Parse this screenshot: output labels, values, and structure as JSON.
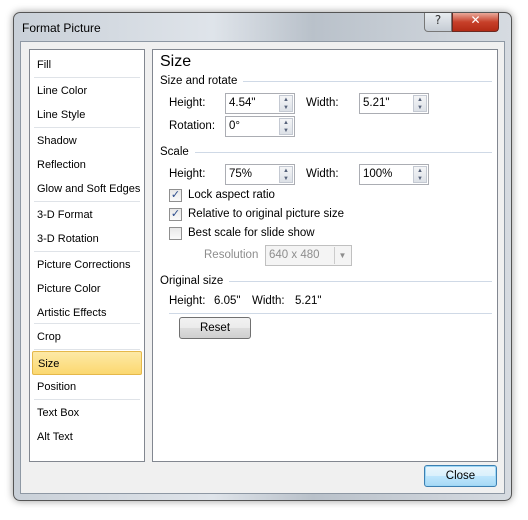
{
  "window": {
    "title": "Format Picture",
    "help": "?",
    "close": "✕"
  },
  "sidebar": {
    "selected": "Size",
    "items": [
      {
        "label": "Fill"
      },
      {
        "label": "Line Color"
      },
      {
        "label": "Line Style"
      },
      {
        "label": "Shadow"
      },
      {
        "label": "Reflection"
      },
      {
        "label": "Glow and Soft Edges"
      },
      {
        "label": "3-D Format"
      },
      {
        "label": "3-D Rotation"
      },
      {
        "label": "Picture Corrections"
      },
      {
        "label": "Picture Color"
      },
      {
        "label": "Artistic Effects"
      },
      {
        "label": "Crop"
      },
      {
        "label": "Size"
      },
      {
        "label": "Position"
      },
      {
        "label": "Text Box"
      },
      {
        "label": "Alt Text"
      }
    ]
  },
  "main": {
    "heading": "Size",
    "size_rotate": {
      "title": "Size and rotate",
      "height_label": "Height:",
      "height": "4.54\"",
      "width_label": "Width:",
      "width": "5.21\"",
      "rotation_label": "Rotation:",
      "rotation": "0°"
    },
    "scale": {
      "title": "Scale",
      "height_label": "Height:",
      "height": "75%",
      "width_label": "Width:",
      "width": "100%",
      "lock_aspect": {
        "label": "Lock aspect ratio",
        "checked": true
      },
      "relative": {
        "label": "Relative to original picture size",
        "checked": true
      },
      "best_scale": {
        "label": "Best scale for slide show",
        "checked": false
      },
      "resolution_label": "Resolution",
      "resolution": "640 x 480"
    },
    "original": {
      "title": "Original size",
      "height_label": "Height:",
      "height": "6.05\"",
      "width_label": "Width:",
      "width": "5.21\""
    },
    "reset": "Reset"
  },
  "footer": {
    "close": "Close"
  }
}
